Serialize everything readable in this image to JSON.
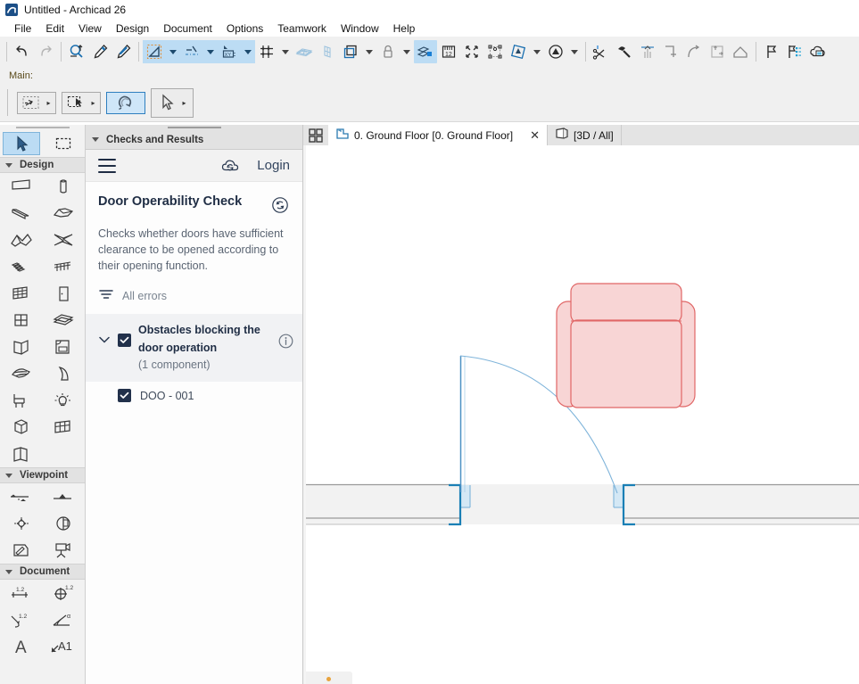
{
  "window": {
    "title": "Untitled - Archicad 26",
    "logo_icon": "archicad-logo-icon"
  },
  "menubar": {
    "items": [
      {
        "label": "File"
      },
      {
        "label": "Edit"
      },
      {
        "label": "View"
      },
      {
        "label": "Design"
      },
      {
        "label": "Document"
      },
      {
        "label": "Options"
      },
      {
        "label": "Teamwork"
      },
      {
        "label": "Window"
      },
      {
        "label": "Help"
      }
    ]
  },
  "toolbar": {
    "buttons": [
      {
        "name": "undo-icon",
        "label": "Undo"
      },
      {
        "name": "redo-icon",
        "label": "Redo"
      },
      {
        "name": "marquee-zoom-icon",
        "label": "Find & Select"
      },
      {
        "name": "eyedropper-icon",
        "label": "Pick Up Parameters"
      },
      {
        "name": "syringe-icon",
        "label": "Inject Parameters"
      },
      {
        "name": "snap-guide-icon",
        "label": "Guide Lines"
      },
      {
        "name": "snap-points-icon",
        "label": "Snap Points"
      },
      {
        "name": "coordinate-input-icon",
        "label": "Coordinate Input"
      },
      {
        "name": "grid-snap-icon",
        "label": "Grid Snap"
      },
      {
        "name": "mesh-icon",
        "label": "Mesh"
      },
      {
        "name": "wireframe-icon",
        "label": "Wireframe"
      },
      {
        "name": "layers-icon",
        "label": "Layers"
      },
      {
        "name": "lock-icon",
        "label": "Lock"
      },
      {
        "name": "3d-cutaway-icon",
        "label": "3D Cutaway"
      },
      {
        "name": "dimension-icon",
        "label": "Dimensions"
      },
      {
        "name": "marker-range-icon",
        "label": "Marker Range"
      },
      {
        "name": "element-transform-icon",
        "label": "Transform"
      },
      {
        "name": "renovation-filter-icon",
        "label": "Renovation Filter"
      },
      {
        "name": "partial-structure-icon",
        "label": "Partial Structure Display"
      },
      {
        "name": "trim-icon",
        "label": "Trim"
      },
      {
        "name": "magic-wand-icon",
        "label": "Magic Wand"
      },
      {
        "name": "align-icon",
        "label": "Align"
      },
      {
        "name": "corner-icon",
        "label": "Corner"
      },
      {
        "name": "curve-icon",
        "label": "Curve"
      },
      {
        "name": "resize-icon",
        "label": "Resize"
      },
      {
        "name": "home-story-icon",
        "label": "Home Story"
      },
      {
        "name": "flag-icon",
        "label": "Mark-Up"
      },
      {
        "name": "flag-list-icon",
        "label": "Mark-Up Entries"
      },
      {
        "name": "cloud-collab-icon",
        "label": "BIMcloud"
      }
    ]
  },
  "main_row": {
    "label": "Main:",
    "buttons": [
      {
        "name": "arrow-select-dashed-icon",
        "label": "Quick Selection",
        "selected": false,
        "has_arrow": true
      },
      {
        "name": "marquee-select-icon",
        "label": "Marquee",
        "selected": false,
        "has_arrow": true
      },
      {
        "name": "drag-rotate-icon",
        "label": "Drag / Rotate",
        "selected": true,
        "has_arrow": false
      },
      {
        "name": "pointer-icon",
        "label": "Arrow Tool",
        "selected": false,
        "has_arrow": true
      }
    ]
  },
  "toolbox": {
    "top_tools": [
      {
        "name": "arrow-tool",
        "icon": "pointer-icon",
        "label": "Arrow",
        "selected": true
      },
      {
        "name": "marquee-tool",
        "icon": "marquee-dashed-icon",
        "label": "Marquee",
        "selected": false
      }
    ],
    "sections": [
      {
        "title": "Design",
        "tools": [
          {
            "name": "wall-tool",
            "icon": "wall-icon",
            "label": "Wall"
          },
          {
            "name": "column-tool",
            "icon": "column-icon",
            "label": "Column"
          },
          {
            "name": "beam-tool",
            "icon": "beam-icon",
            "label": "Beam"
          },
          {
            "name": "slab-tool",
            "icon": "slab-icon",
            "label": "Slab"
          },
          {
            "name": "roof-tool",
            "icon": "roof-icon",
            "label": "Roof"
          },
          {
            "name": "shell-tool",
            "icon": "shell-icon",
            "label": "Shell"
          },
          {
            "name": "stair-tool",
            "icon": "stair-icon",
            "label": "Stair"
          },
          {
            "name": "railing-tool",
            "icon": "railing-icon",
            "label": "Railing"
          },
          {
            "name": "curtain-wall-tool",
            "icon": "curtain-wall-icon",
            "label": "Curtain Wall"
          },
          {
            "name": "door-tool",
            "icon": "door-icon",
            "label": "Door"
          },
          {
            "name": "window-tool",
            "icon": "window-icon",
            "label": "Window"
          },
          {
            "name": "skylight-tool",
            "icon": "skylight-icon",
            "label": "Skylight"
          },
          {
            "name": "wall-end-tool",
            "icon": "wall-end-icon",
            "label": "Wall End"
          },
          {
            "name": "object-tool",
            "icon": "furniture-object-icon",
            "label": "Object"
          },
          {
            "name": "morph-tool",
            "icon": "morph-icon",
            "label": "Morph"
          },
          {
            "name": "zone-tool",
            "icon": "zone-icon",
            "label": "Zone"
          },
          {
            "name": "chair-object-tool",
            "icon": "chair-icon",
            "label": "Chair Object"
          },
          {
            "name": "lamp-tool",
            "icon": "lamp-icon",
            "label": "Lamp"
          },
          {
            "name": "mep-tool",
            "icon": "mep-box-icon",
            "label": "MEP"
          },
          {
            "name": "grid-element-tool",
            "icon": "grid-element-icon",
            "label": "Grid Element"
          },
          {
            "name": "opening-tool",
            "icon": "opening-icon",
            "label": "Opening"
          }
        ]
      },
      {
        "title": "Viewpoint",
        "tools": [
          {
            "name": "section-tool",
            "icon": "section-marker-icon",
            "label": "Section"
          },
          {
            "name": "elevation-tool",
            "icon": "elevation-marker-icon",
            "label": "Elevation"
          },
          {
            "name": "interior-elevation-tool",
            "icon": "interior-elevation-icon",
            "label": "Interior Elevation"
          },
          {
            "name": "detail-tool",
            "icon": "detail-circle-icon",
            "label": "Detail"
          },
          {
            "name": "worksheet-tool",
            "icon": "worksheet-pencil-icon",
            "label": "Worksheet"
          },
          {
            "name": "camera-tool",
            "icon": "camera-icon",
            "label": "Camera"
          }
        ]
      },
      {
        "title": "Document",
        "tools": [
          {
            "name": "linear-dimension-tool",
            "icon": "linear-dimension-icon",
            "label": "Dimension"
          },
          {
            "name": "level-dimension-tool",
            "icon": "level-dimension-icon",
            "label": "Level Dimension"
          },
          {
            "name": "radial-dimension-tool",
            "icon": "radial-dimension-icon",
            "label": "Radial Dimension"
          },
          {
            "name": "angle-dimension-tool",
            "icon": "angle-dimension-icon",
            "label": "Angle Dimension"
          },
          {
            "name": "text-tool",
            "icon": "text-a-icon",
            "label": "Text"
          },
          {
            "name": "label-tool",
            "icon": "label-a1-icon",
            "label": "Label"
          }
        ]
      }
    ]
  },
  "panel": {
    "header": "Checks and Results",
    "header_chevron_icon": "chevron-down-icon",
    "hamburger_icon": "hamburger-menu-icon",
    "cloud_icon": "cloud-sync-icon",
    "login_label": "Login",
    "check_title": "Door Operability Check",
    "refresh_icon": "refresh-circle-icon",
    "check_description": "Checks whether doors have sufficient clearance to be opened according to their opening function.",
    "filter_icon": "filter-icon",
    "filter_label": "All errors",
    "issue_groups": [
      {
        "name": "issue-group-obstacles",
        "title": "Obstacles blocking the door operation",
        "subtitle": "(1 component)",
        "checked": true,
        "expanded": true,
        "chevron_icon": "chevron-down-icon",
        "info_icon": "info-circle-icon",
        "items": [
          {
            "name": "issue-item-doo-001",
            "label": "DOO - 001",
            "checked": true
          }
        ]
      }
    ]
  },
  "canvas": {
    "grid_button_icon": "tab-grid-icon",
    "tabs": [
      {
        "name": "tab-ground-floor",
        "label": "0. Ground Floor [0. Ground Floor]",
        "icon": "floor-plan-icon",
        "active": true,
        "closable": true,
        "close_icon": "close-icon"
      },
      {
        "name": "tab-3d-all",
        "label": "[3D / All]",
        "icon": "3d-cube-icon",
        "active": false,
        "closable": false
      }
    ]
  },
  "drawing": {
    "description": "Floor plan showing a door with its swing arc colliding with an armchair",
    "colors": {
      "door_leaf": "#4a90c4",
      "door_arc": "#7fb4da",
      "wall_fill": "#f2f2f2",
      "wall_line": "#9a9a9a",
      "wall_highlight": "#1a7fb5",
      "opening_fill": "#d4e8f5",
      "furniture_line": "#e06666",
      "furniture_fill": "#f8d5d5"
    },
    "elements": [
      {
        "name": "wall-left",
        "type": "wall"
      },
      {
        "name": "wall-right",
        "type": "wall"
      },
      {
        "name": "door-leaf",
        "type": "door"
      },
      {
        "name": "door-swing-arc",
        "type": "arc"
      },
      {
        "name": "armchair",
        "type": "furniture"
      }
    ]
  }
}
